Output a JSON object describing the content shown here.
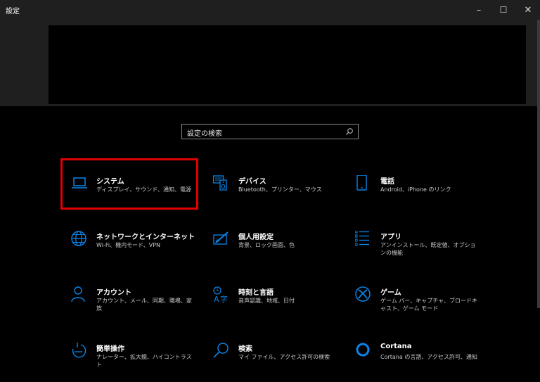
{
  "window": {
    "title": "設定",
    "minimize": "–",
    "maximize": "☐",
    "close": "✕"
  },
  "search": {
    "placeholder": "設定の検索"
  },
  "tiles": [
    {
      "title": "システム",
      "desc": "ディスプレイ、サウンド、通知、電源",
      "icon": "laptop-icon"
    },
    {
      "title": "デバイス",
      "desc": "Bluetooth、プリンター、マウス",
      "icon": "keyboard-speaker-icon"
    },
    {
      "title": "電話",
      "desc": "Android、iPhone のリンク",
      "icon": "phone-icon"
    },
    {
      "title": "ネットワークとインターネット",
      "desc": "Wi-Fi、機内モード、VPN",
      "icon": "globe-icon"
    },
    {
      "title": "個人用設定",
      "desc": "背景、ロック画面、色",
      "icon": "paint-pen-icon"
    },
    {
      "title": "アプリ",
      "desc": "アンインストール、既定値、オプションの機能",
      "icon": "apps-list-icon"
    },
    {
      "title": "アカウント",
      "desc": "アカウント、メール、同期、職場、家族",
      "icon": "person-icon"
    },
    {
      "title": "時刻と言語",
      "desc": "音声認識、地域、日付",
      "icon": "time-language-icon"
    },
    {
      "title": "ゲーム",
      "desc": "ゲーム バー、キャプチャ、ブロードキャスト、ゲーム モード",
      "icon": "xbox-icon"
    },
    {
      "title": "簡単操作",
      "desc": "ナレーター、拡大鏡、ハイコントラスト",
      "icon": "ease-of-access-icon"
    },
    {
      "title": "検索",
      "desc": "マイ ファイル、アクセス許可の検索",
      "icon": "search-icon"
    },
    {
      "title": "Cortana",
      "desc": "Cortana の言語、アクセス許可、通知",
      "icon": "cortana-icon"
    }
  ],
  "colors": {
    "accent": "#0a84e8",
    "highlight": "#e00000"
  }
}
